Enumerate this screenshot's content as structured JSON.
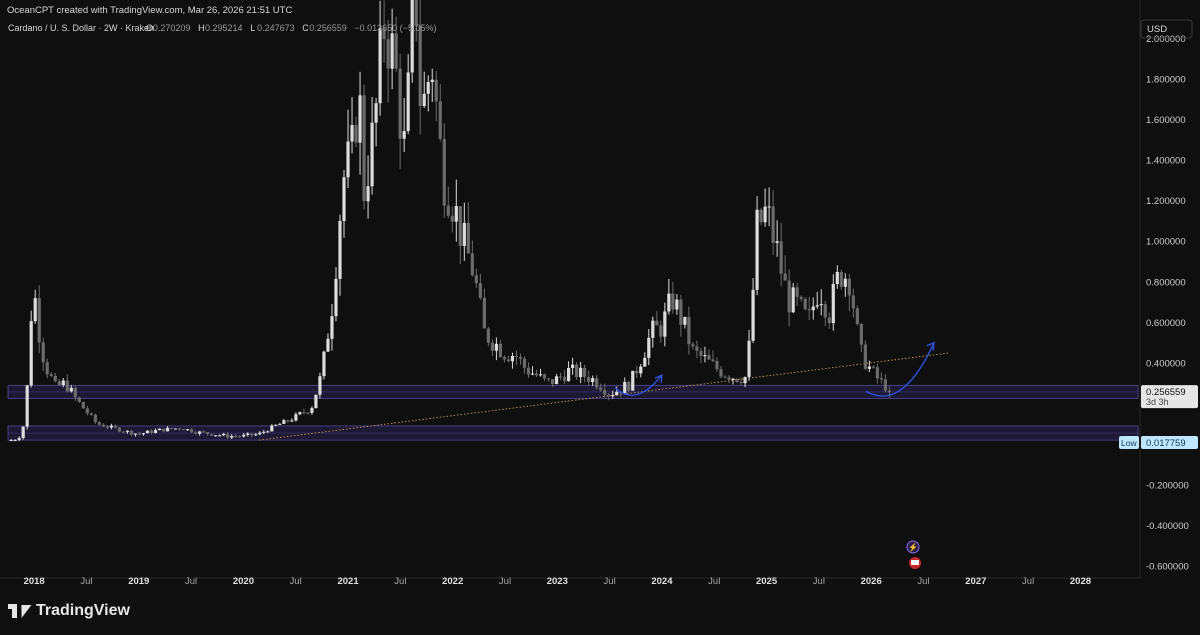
{
  "header": {
    "created_by": "OceanCPT created with TradingView.com, Mar 26, 2026 21:51 UTC",
    "symbol": "Cardano / U. S. Dollar · 2W · Kraken",
    "o_label": "O",
    "o_value": "0.270209",
    "h_label": "H",
    "h_value": "0.295214",
    "l_label": "L",
    "l_value": "0.247673",
    "c_label": "C",
    "c_value": "0.256559",
    "change": "−0.013650 (−5.05%)"
  },
  "currency_label": "USD",
  "price_tag": {
    "value": "0.256559",
    "countdown": "3d 3h"
  },
  "low_tag": {
    "label": "Low",
    "value": "0.017759"
  },
  "footer": {
    "brand": "TradingView"
  },
  "colors": {
    "background": "#0f0f0f",
    "candle_up": "#dcdcdc",
    "candle_down": "#6b6b6b",
    "zone_fill": "#1f1b3a",
    "zone_border": "#7b6cd9",
    "trendline": "#c7a34b",
    "arrow": "#3050d8",
    "low_tag_bg": "#bfe6ff",
    "price_tag_bg": "#e6e6e6"
  },
  "chart_data": {
    "type": "candlestick",
    "ylim": [
      -0.62,
      2.1
    ],
    "y_ticks": [
      "2.000000",
      "1.800000",
      "1.600000",
      "1.400000",
      "1.200000",
      "1.000000",
      "0.800000",
      "0.600000",
      "0.400000",
      "-0.200000",
      "-0.400000",
      "-0.600000"
    ],
    "y_tick_values": [
      2.0,
      1.8,
      1.6,
      1.4,
      1.2,
      1.0,
      0.8,
      0.6,
      0.4,
      -0.2,
      -0.4,
      -0.6
    ],
    "x_ticks": [
      "2018",
      "Jul",
      "2019",
      "Jul",
      "2020",
      "Jul",
      "2021",
      "Jul",
      "2022",
      "Jul",
      "2023",
      "Jul",
      "2024",
      "Jul",
      "2025",
      "Jul",
      "2026",
      "Jul",
      "2027",
      "Jul",
      "2028"
    ],
    "x_tick_values": [
      2018.0,
      2018.5,
      2019.0,
      2019.5,
      2020.0,
      2020.5,
      2021.0,
      2021.5,
      2022.0,
      2022.5,
      2023.0,
      2023.5,
      2024.0,
      2024.5,
      2025.0,
      2025.5,
      2026.0,
      2026.5,
      2027.0,
      2027.5,
      2028.0
    ],
    "xlim": [
      2017.75,
      2028.55
    ],
    "bold_x_ticks": [
      "2018",
      "2019",
      "2020",
      "2021",
      "2022",
      "2023",
      "2024",
      "2025",
      "2026",
      "2027",
      "2028"
    ],
    "support_zones": [
      [
        0.225,
        0.29
      ],
      [
        0.02,
        0.09
      ]
    ],
    "trendline": {
      "x": [
        2020.15,
        2026.75
      ],
      "y": [
        0.02,
        0.45
      ]
    },
    "close_series": {
      "x": [
        2017.78,
        2017.85,
        2017.92,
        2017.96,
        2018.0,
        2018.05,
        2018.1,
        2018.2,
        2018.3,
        2018.4,
        2018.5,
        2018.6,
        2018.75,
        2018.9,
        2019.0,
        2019.2,
        2019.4,
        2019.55,
        2019.7,
        2019.85,
        2020.0,
        2020.15,
        2020.3,
        2020.45,
        2020.55,
        2020.65,
        2020.75,
        2020.85,
        2020.95,
        2021.05,
        2021.1,
        2021.15,
        2021.25,
        2021.35,
        2021.45,
        2021.55,
        2021.6,
        2021.65,
        2021.7,
        2021.8,
        2021.9,
        2022.0,
        2022.1,
        2022.2,
        2022.3,
        2022.4,
        2022.5,
        2022.6,
        2022.7,
        2022.8,
        2022.9,
        2023.0,
        2023.1,
        2023.2,
        2023.3,
        2023.4,
        2023.5,
        2023.6,
        2023.7,
        2023.8,
        2023.9,
        2024.0,
        2024.1,
        2024.2,
        2024.3,
        2024.4,
        2024.5,
        2024.6,
        2024.7,
        2024.8,
        2024.85,
        2024.9,
        2025.0,
        2025.1,
        2025.2,
        2025.3,
        2025.4,
        2025.5,
        2025.6,
        2025.7,
        2025.8,
        2025.85,
        2025.9,
        2026.0,
        2026.1,
        2026.2
      ],
      "y": [
        0.02,
        0.03,
        0.12,
        0.6,
        0.75,
        0.55,
        0.4,
        0.28,
        0.3,
        0.22,
        0.16,
        0.1,
        0.08,
        0.06,
        0.05,
        0.07,
        0.08,
        0.06,
        0.05,
        0.04,
        0.04,
        0.05,
        0.09,
        0.12,
        0.15,
        0.18,
        0.35,
        0.7,
        1.3,
        1.45,
        1.8,
        1.25,
        1.55,
        2.1,
        1.85,
        1.4,
        2.0,
        2.2,
        1.6,
        1.9,
        1.35,
        1.2,
        1.0,
        0.85,
        0.55,
        0.5,
        0.45,
        0.44,
        0.37,
        0.34,
        0.3,
        0.32,
        0.36,
        0.35,
        0.33,
        0.3,
        0.25,
        0.27,
        0.3,
        0.42,
        0.55,
        0.58,
        0.72,
        0.6,
        0.45,
        0.42,
        0.38,
        0.35,
        0.33,
        0.33,
        0.55,
        1.05,
        1.15,
        0.95,
        0.72,
        0.68,
        0.6,
        0.78,
        0.65,
        0.85,
        0.82,
        0.6,
        0.45,
        0.36,
        0.3,
        0.27
      ]
    }
  }
}
